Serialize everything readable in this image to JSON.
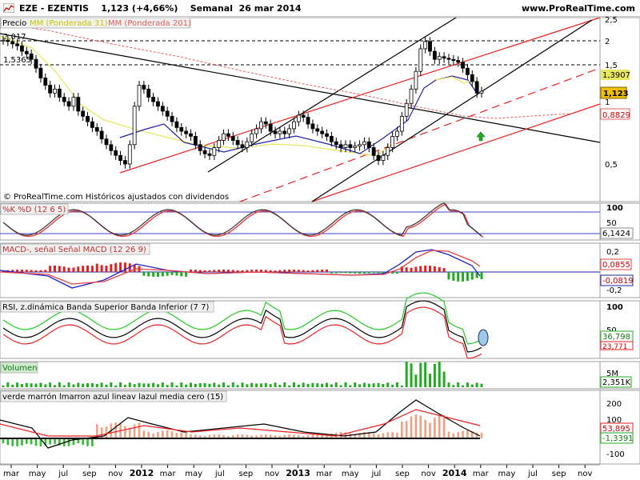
{
  "header": {
    "symbol": "EZE - EZENTIS",
    "price_change": "1,123 (+4,66%)",
    "period": "Semanal",
    "date": "26 mar 2014",
    "site": "www.ProRealTime.com"
  },
  "colors": {
    "price_up": "#ffffff",
    "price_down": "#000000",
    "ma31": "#e8e860",
    "ma201": "#e86060",
    "channel": "#ee2222",
    "trend": "#000000",
    "k": "#333333",
    "d": "#e84040",
    "macd": "#2020cc",
    "signal": "#e84040",
    "hist_pos": "#22aa22",
    "hist_neg": "#dd2222",
    "rsi": "#000000",
    "band_sup": "#22cc22",
    "band_inf": "#ee2222",
    "vol": "#22aa22"
  },
  "chart_data": [
    {
      "type": "candlestick",
      "legend": [
        "Precio",
        "MM (Ponderada 31)",
        "MM (Ponderada 201)"
      ],
      "yticks": [
        "2,5",
        "2",
        "1,5",
        "1",
        "0,5"
      ],
      "levels": {
        "upper_dashed": "2",
        "lower_dashed": "1,5365",
        "top_left": "2,017"
      },
      "price_labels": {
        "last": "1,123",
        "ma31": "1,3907",
        "ma201": "0,8829"
      },
      "annotation": "© ProRealTime.com  Históricos ajustados con dividendos",
      "x_ticks": [
        "mar",
        "may",
        "jul",
        "sep",
        "nov",
        "2012",
        "mar",
        "may",
        "jul",
        "sep",
        "nov",
        "2013",
        "mar",
        "may",
        "jul",
        "sep",
        "nov",
        "2014",
        "mar",
        "may",
        "jul",
        "sep",
        "nov"
      ],
      "close": [
        1.98,
        1.95,
        1.9,
        1.86,
        1.75,
        1.7,
        1.6,
        1.45,
        1.3,
        1.2,
        1.1,
        1.15,
        1.05,
        1,
        0.95,
        1.05,
        0.9,
        0.85,
        0.8,
        0.75,
        0.72,
        0.66,
        0.62,
        0.58,
        0.55,
        0.52,
        0.5,
        0.62,
        0.95,
        1.2,
        1.15,
        1.05,
        1,
        0.95,
        0.9,
        0.85,
        0.8,
        0.75,
        0.72,
        0.7,
        0.68,
        0.62,
        0.58,
        0.56,
        0.55,
        0.6,
        0.65,
        0.7,
        0.68,
        0.65,
        0.62,
        0.6,
        0.64,
        0.7,
        0.74,
        0.8,
        0.78,
        0.72,
        0.7,
        0.72,
        0.7,
        0.74,
        0.8,
        0.86,
        0.84,
        0.78,
        0.74,
        0.72,
        0.7,
        0.68,
        0.64,
        0.62,
        0.6,
        0.62,
        0.6,
        0.61,
        0.62,
        0.64,
        0.6,
        0.55,
        0.52,
        0.55,
        0.6,
        0.68,
        0.72,
        0.85,
        0.98,
        1.15,
        1.4,
        1.8,
        1.95,
        1.75,
        1.6,
        1.65,
        1.62,
        1.6,
        1.58,
        1.55,
        1.45,
        1.35,
        1.25,
        1.1,
        1.123
      ],
      "ma31_first": 2.0,
      "ma201_first": 2.2
    },
    {
      "type": "line",
      "title": "%K  %D (12 6 5)",
      "yticks": [
        "100",
        "50"
      ],
      "last_label": "6,1424"
    },
    {
      "type": "bar",
      "title": "MACD-, señal  Señal  MACD (12 26 9)",
      "yticks": [
        "0,2",
        "-0,2"
      ],
      "last_labels": [
        "0,0855",
        "-0,0819"
      ]
    },
    {
      "type": "line",
      "title": "RSI, z.dinámica  Banda Superior  Banda Inferior (7 7)",
      "yticks": [
        "100",
        "50"
      ],
      "last_labels": [
        "36,798",
        "23,771"
      ]
    },
    {
      "type": "bar",
      "title": "Volumen",
      "yticks": [
        "5M"
      ],
      "last_label": "2,351K"
    },
    {
      "type": "area",
      "title": "verde  marrón  lmarron  azul  lineav  lazul  media  cero (15)",
      "yticks": [
        "200",
        "100",
        "0",
        "-100"
      ],
      "last_labels": [
        "53,895",
        "-1,3391"
      ]
    }
  ]
}
